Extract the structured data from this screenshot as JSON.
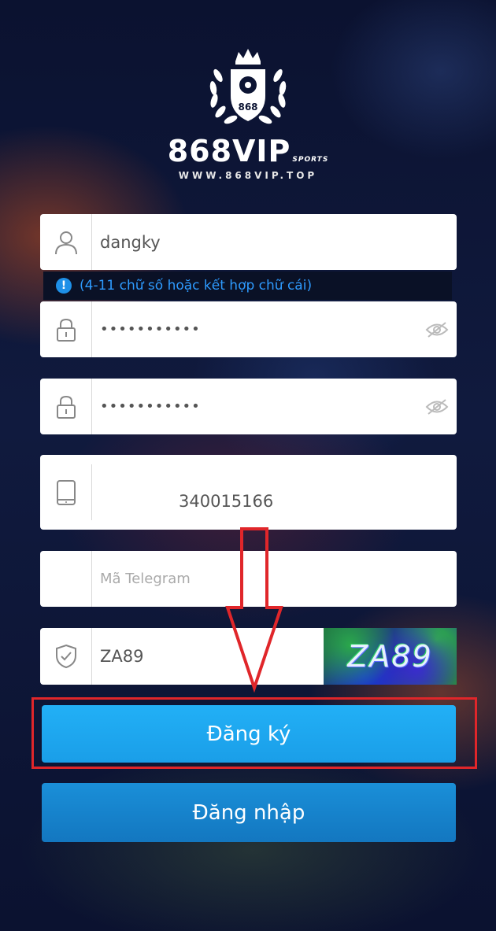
{
  "logo": {
    "badge_number": "868",
    "brand_text": "868VIP",
    "brand_suffix": "SPORTS",
    "site_url": "WWW.868VIP.TOP"
  },
  "form": {
    "username": {
      "value": "dangky",
      "icon": "user-icon"
    },
    "hint": {
      "text": "(4-11 chữ số hoặc kết hợp chữ cái)",
      "icon": "info-icon"
    },
    "password": {
      "value": "•••••••••••",
      "icon": "lock-icon",
      "toggle_icon": "eye-off-icon"
    },
    "confirm_password": {
      "value": "•••••••••••",
      "icon": "lock-icon",
      "toggle_icon": "eye-off-icon"
    },
    "phone": {
      "value": "340015166",
      "icon": "phone-icon"
    },
    "telegram": {
      "placeholder": "Mã Telegram"
    },
    "captcha": {
      "value": "ZA89",
      "image_text": "ZA89",
      "icon": "shield-check-icon"
    }
  },
  "buttons": {
    "register_label": "Đăng ký",
    "login_label": "Đăng nhập"
  },
  "colors": {
    "primary_button": "#1ea8f0",
    "secondary_button": "#1584cc",
    "hint_text": "#2e9bff",
    "annotation_red": "#e0262a"
  }
}
